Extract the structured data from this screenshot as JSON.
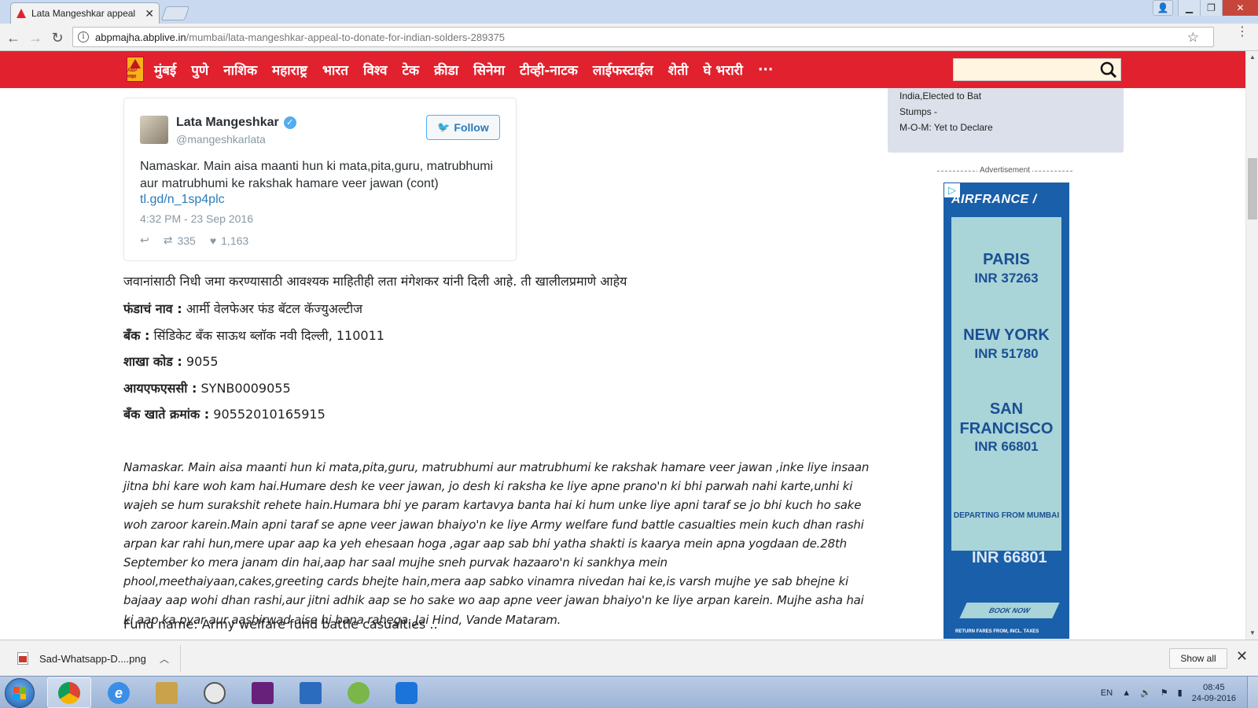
{
  "browser": {
    "tab_title": "Lata Mangeshkar appeal",
    "url_domain": "abpmajha.abplive.in",
    "url_path": "/mumbai/lata-mangeshkar-appeal-to-donate-for-indian-solders-289375"
  },
  "site": {
    "logo_text": "ABP माझा",
    "nav_items": [
      "मुंबई",
      "पुणे",
      "नाशिक",
      "महाराष्ट्र",
      "भारत",
      "विश्व",
      "टेक",
      "क्रीडा",
      "सिनेमा",
      "टीव्ही-नाटक",
      "लाईफस्टाईल",
      "शेती",
      "घे भरारी",
      "···"
    ],
    "accent": "#e2212e"
  },
  "tweet": {
    "name": "Lata Mangeshkar",
    "handle": "@mangeshkarlata",
    "follow_label": "Follow",
    "text": "Namaskar. Main aisa maanti hun ki mata,pita,guru, matrubhumi aur matrubhumi ke rakshak hamare veer jawan (cont)",
    "link": "tl.gd/n_1sp4plc",
    "date": "4:32 PM - 23 Sep 2016",
    "retweets": "335",
    "likes": "1,163"
  },
  "article": {
    "intro": "जवानांसाठी निधी जमा करण्यासाठी आवश्यक माहितीही लता मंगेशकर यांनी दिली आहे. ती खालीलप्रमाणे आहेय",
    "fields": [
      {
        "label": "फंडाचं नाव :",
        "value": " आर्मी वेलफेअर फंड बॅटल कॅज्युअल्टीज"
      },
      {
        "label": "बँक :",
        "value": " सिंडिकेट बँक साऊथ ब्लॉक नवी दिल्ली, 110011"
      },
      {
        "label": "शाखा कोड :",
        "value": " 9055"
      },
      {
        "label": "आयएफएससी :",
        "value": " SYNB0009055"
      },
      {
        "label": "बँक खाते क्रमांक :",
        "value": " 90552010165915"
      }
    ],
    "italic_text": "Namaskar. Main aisa maanti hun ki mata,pita,guru, matrubhumi aur matrubhumi ke rakshak hamare veer jawan ,inke liye insaan jitna bhi kare woh kam hai.Humare desh ke veer jawan, jo desh ki raksha ke liye apne prano'n ki bhi parwah nahi karte,unhi ki wajeh se hum surakshit rehete hain.Humara bhi ye param kartavya banta hai ki hum unke liye apni taraf se jo bhi kuch ho sake woh zaroor karein.Main apni taraf se apne veer jawan bhaiyo'n ke liye Army welfare fund battle casualties mein kuch dhan rashi arpan kar rahi hun,mere upar aap ka yeh ehesaan hoga ,agar aap sab bhi yatha shakti is kaarya mein apna yogdaan de.28th September ko mera janam din hai,aap har saal mujhe sneh purvak hazaaro'n ki sankhya mein phool,meethaiyaan,cakes,greeting cards bhejte hain,mera aap sabko vinamra nivedan hai ke,is varsh mujhe ye sab bhejne ki bajaay aap wohi dhan rashi,aur jitni adhik aap se ho sake wo aap apne veer jawan bhaiyo'n ke liye arpan karein. Mujhe asha hai ki aap ka pyar aur aashirwad aise hi bana rahega. Jai Hind, Vande Mataram.",
    "fund_name": "Fund name: Army welfare fund battle casualties .."
  },
  "sidebar": {
    "score_lines": [
      "India,Elected to Bat",
      "Stumps -",
      "M-O-M: Yet to Declare"
    ],
    "ad_label": "Advertisement",
    "ad": {
      "brand": "AIRFRANCE /",
      "destinations": [
        {
          "city": "PARIS",
          "price": "INR 37263"
        },
        {
          "city": "NEW YORK",
          "price": "INR 51780"
        },
        {
          "city": "SAN FRANCISCO",
          "price": "INR 66801"
        }
      ],
      "departing": "DEPARTING FROM MUMBAI",
      "ghost_price": "INR 66801",
      "book": "BOOK NOW",
      "fine_print": "RETURN FARES FROM, INCL. TAXES"
    }
  },
  "downloads": {
    "file_name": "Sad-Whatsapp-D....png",
    "show_all": "Show all"
  },
  "taskbar": {
    "lang": "EN",
    "time": "08:45",
    "date": "24-09-2016"
  }
}
